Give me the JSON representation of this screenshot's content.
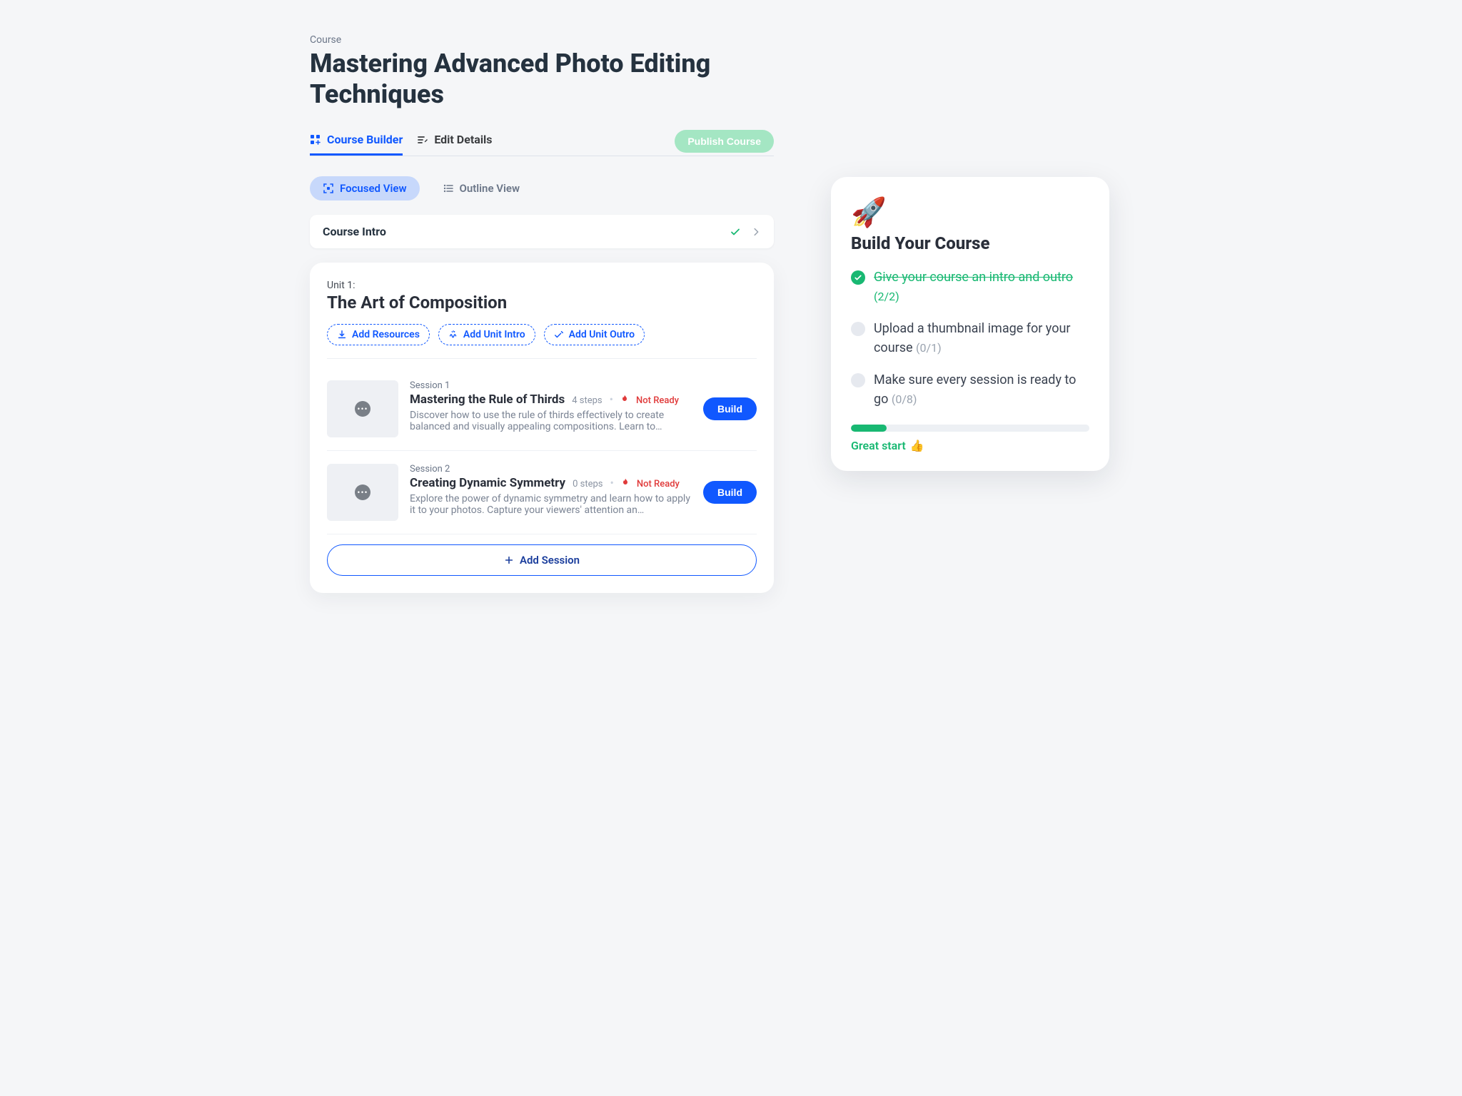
{
  "header": {
    "eyebrow": "Course",
    "title": "Mastering Advanced Photo Editing Techniques"
  },
  "tabs": {
    "builder": "Course Builder",
    "edit": "Edit Details",
    "publish": "Publish Course"
  },
  "views": {
    "focused": "Focused View",
    "outline": "Outline View"
  },
  "intro": {
    "label": "Course Intro"
  },
  "unit": {
    "eyebrow": "Unit 1:",
    "title": "The Art of Composition",
    "chips": {
      "resources": "Add Resources",
      "intro": "Add Unit Intro",
      "outro": "Add Unit Outro"
    },
    "sessions": [
      {
        "eyebrow": "Session 1",
        "title": "Mastering the Rule of Thirds",
        "steps": "4 steps",
        "status": "Not Ready",
        "desc": "Discover how to use the rule of thirds effectively to create balanced and visually appealing compositions. Learn to…",
        "btn": "Build"
      },
      {
        "eyebrow": "Session 2",
        "title": "Creating Dynamic Symmetry",
        "steps": "0 steps",
        "status": "Not Ready",
        "desc": "Explore the power of dynamic symmetry and learn how to apply it to your photos. Capture your viewers' attention an…",
        "btn": "Build"
      }
    ],
    "add_session": "Add Session"
  },
  "side": {
    "emoji": "🚀",
    "title": "Build Your Course",
    "items": [
      {
        "done": true,
        "text": "Give your course an intro and outro",
        "count": "(2/2)"
      },
      {
        "done": false,
        "text": "Upload a thumbnail image for your course",
        "count": "(0/1)"
      },
      {
        "done": false,
        "text": "Make sure every session is ready to go",
        "count": "(0/8)"
      }
    ],
    "progress_pct": 15,
    "progress_label": "Great start",
    "progress_emoji": "👍"
  }
}
